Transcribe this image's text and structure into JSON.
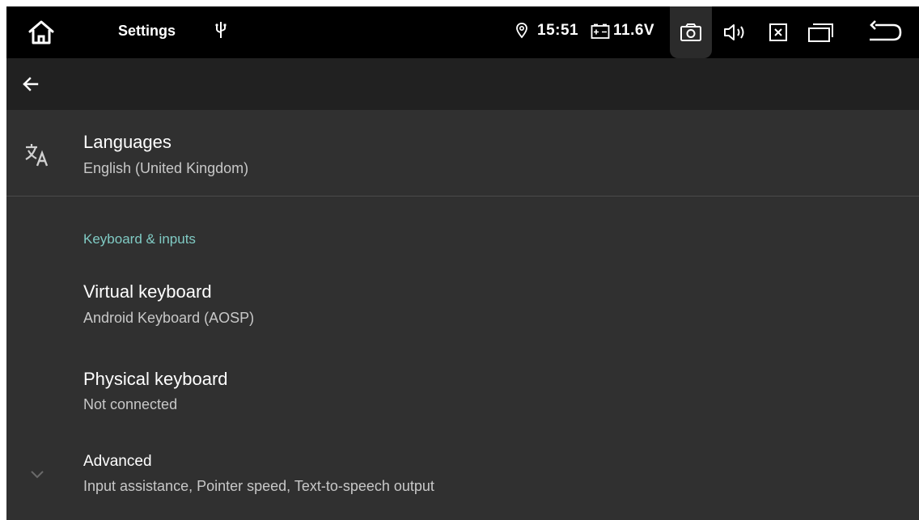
{
  "status_bar": {
    "title": "Settings",
    "time": "15:51",
    "voltage": "11.6V",
    "icons": [
      "home-icon",
      "usb-icon",
      "location-icon",
      "battery-icon",
      "camera-icon",
      "volume-icon",
      "close-box-icon",
      "recents-icon",
      "back-arrow-icon"
    ]
  },
  "app_bar": {
    "icons": [
      "arrow-back-icon"
    ]
  },
  "languages": {
    "title": "Languages",
    "summary": "English (United Kingdom)",
    "icon": "translate-icon"
  },
  "keyboard_section": {
    "header": "Keyboard & inputs",
    "virtual_keyboard": {
      "title": "Virtual keyboard",
      "summary": "Android Keyboard (AOSP)"
    },
    "physical_keyboard": {
      "title": "Physical keyboard",
      "summary": "Not connected"
    },
    "advanced": {
      "title": "Advanced",
      "summary": "Input assistance, Pointer speed, Text-to-speech output",
      "icon": "chevron-down-icon"
    }
  },
  "colors": {
    "accent": "#80cbc4",
    "background": "#303030",
    "app_bar": "#212121",
    "status_bar": "#000000"
  }
}
